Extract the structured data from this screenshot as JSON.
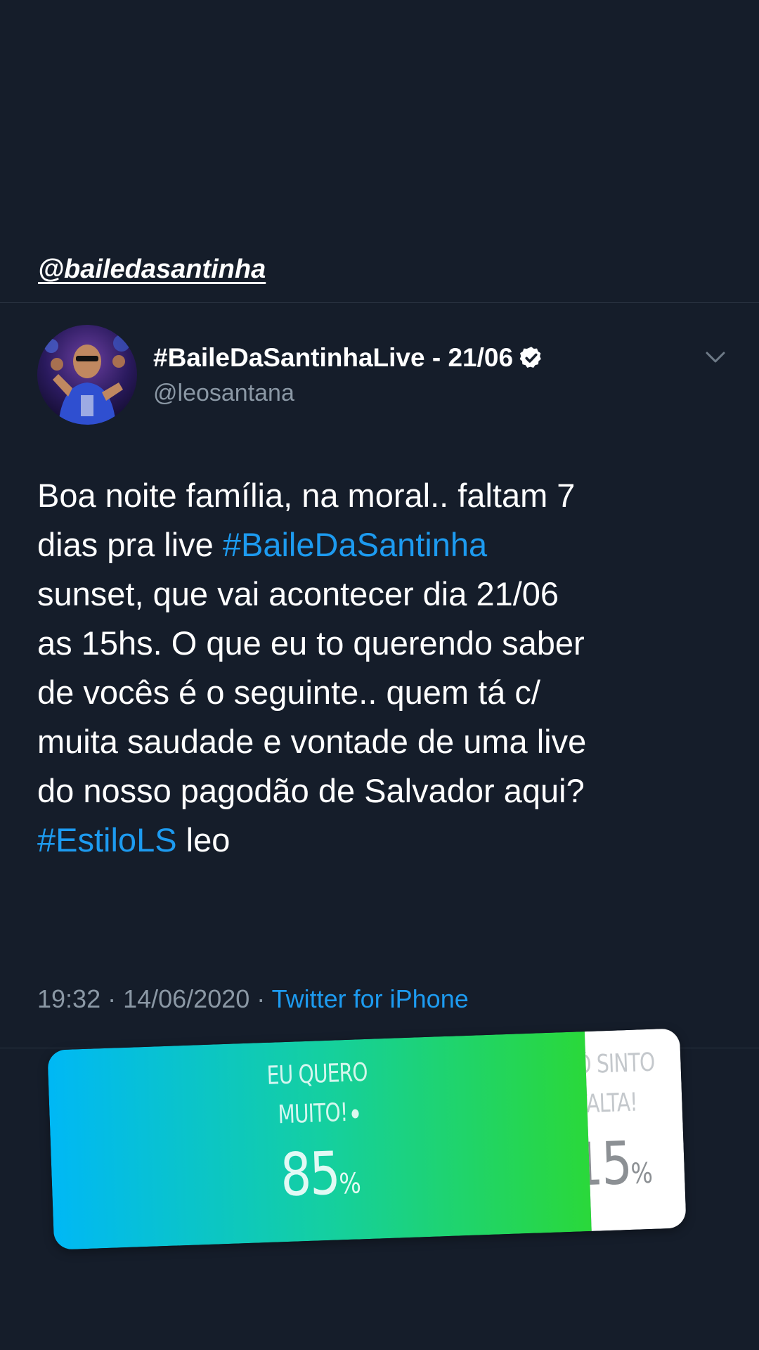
{
  "story": {
    "mention": "@bailedasantinha"
  },
  "tweet": {
    "display_name": "#BaileDaSantinhaLive - 21/06",
    "handle": "@leosantana",
    "text_lines": [
      [
        {
          "t": "Boa noite família, na moral.. faltam 7"
        }
      ],
      [
        {
          "t": "dias pra live "
        },
        {
          "t": "#BaileDaSantinha",
          "tag": true
        }
      ],
      [
        {
          "t": "sunset, que vai acontecer dia 21/06"
        }
      ],
      [
        {
          "t": "as 15hs. O que eu to querendo saber"
        }
      ],
      [
        {
          "t": "de vocês é o seguinte.. quem tá c/"
        }
      ],
      [
        {
          "t": "muita saudade e vontade de uma live"
        }
      ],
      [
        {
          "t": "do nosso pagodão de Salvador aqui?"
        }
      ],
      [
        {
          "t": "#EstiloLS",
          "tag": true
        },
        {
          "t": " leo"
        }
      ]
    ],
    "time": "19:32",
    "date": "14/06/2020",
    "separator": " · ",
    "source": "Twitter for iPhone"
  },
  "poll": {
    "options": [
      {
        "label_lines": [
          "EU QUERO",
          "MUITO!"
        ],
        "percent": 85,
        "percent_text": "85",
        "selected": true
      },
      {
        "label_lines": [
          "Ô SINTO",
          "FALTA!"
        ],
        "percent": 15,
        "percent_text": "15",
        "selected": false
      }
    ],
    "percent_sign": "%"
  },
  "colors": {
    "background": "#151d2a",
    "link": "#1d9bf0",
    "secondary_text": "#8b98a5",
    "poll_gradient_start": "#00b8f5",
    "poll_gradient_end": "#2ad83a"
  },
  "icons": {
    "verified": "verified-badge-icon",
    "chevron": "chevron-down-icon"
  }
}
